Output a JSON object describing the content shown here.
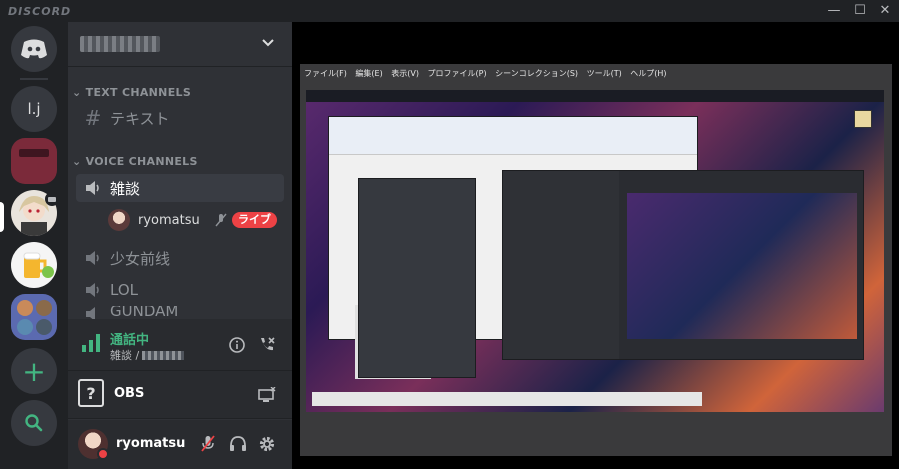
{
  "titlebar": {
    "brand": "DISCORD",
    "minimize": "—",
    "maximize": "☐",
    "close": "✕"
  },
  "servers": [
    {
      "name": "home",
      "label": ""
    },
    {
      "name": "server-lj",
      "label": "l.j"
    },
    {
      "name": "server-maroon",
      "label": ""
    },
    {
      "name": "server-anime",
      "label": ""
    },
    {
      "name": "server-beer",
      "label": ""
    },
    {
      "name": "server-folder",
      "label": ""
    }
  ],
  "sidebar": {
    "text_category": "TEXT CHANNELS",
    "text_channel": "テキスト",
    "voice_category": "VOICE CHANNELS",
    "voice_channels": [
      "雑談",
      "少女前线",
      "LOL",
      "GUNDAM"
    ],
    "member": {
      "name": "ryomatsu",
      "live": "ライブ"
    }
  },
  "voice_panel": {
    "status": "通話中",
    "location": "雑談 / "
  },
  "obs": {
    "icon": "?",
    "title": "OBS"
  },
  "user": {
    "name": "ryomatsu"
  },
  "capture_menu": [
    "ファイル(F)",
    "編集(E)",
    "表示(V)",
    "プロファイル(P)",
    "シーンコレクション(S)",
    "ツール(T)",
    "ヘルプ(H)"
  ],
  "colors": {
    "green": "#43b581",
    "red": "#ed4245",
    "bg": "#2f3136"
  }
}
